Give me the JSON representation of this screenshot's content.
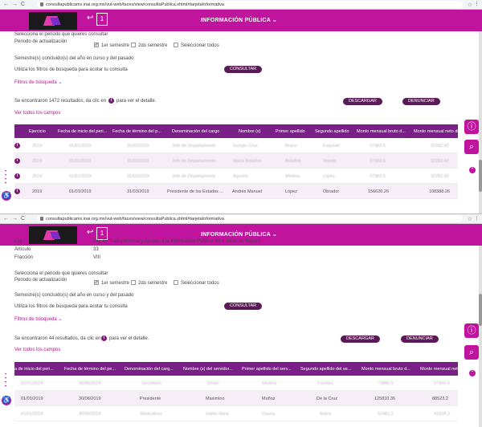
{
  "browser": {
    "url1": "consultapublicamx.inai.org.mx/vut-web/faces/view/consultaPublica.xhtml#tarjetaInformativa",
    "url2": "consultapublicamx.inai.org.mx/vut-web/faces/view/consultaPublica.xhtml#tarjetaInformativa",
    "back_glyph": "←",
    "forward_glyph": "→",
    "reload_glyph": "C",
    "star_glyph": "☆",
    "menu_glyph": "⋮"
  },
  "header": {
    "title": "INFORMACIÓN PÚBLICA ⌄",
    "back_glyph": "↩",
    "badge": "1"
  },
  "shot1": {
    "period_prompt": "Selecciona el periodo que quieres consultar",
    "period_label": "Periodo de actualización",
    "options": [
      "1er semestre",
      "2do semestre",
      "Seleccionar todos"
    ],
    "semester_note": "Semestre(s) concluido(s) del año en curso y del pasado",
    "filter_hint": "Utiliza los filtros de búsqueda para acotar tu consulta",
    "consult_button": "CONSULTAR",
    "filters_link": "Filtros de búsqueda ⌄",
    "results_text_a": "Se encontraron 1472 resultados, da clic en",
    "results_text_b": "para ver el detalle.",
    "download_button": "DESCARGAR",
    "report_button": "DENUNCIAR",
    "all_fields_link": "Ver todos los campos",
    "columns": [
      "Ejercicio",
      "Fecha de inicio del peri...",
      "Fecha de término del p...",
      "Denominación del cargo",
      "Nombre (s)",
      "Primer apellido",
      "Segundo apellido",
      "Monto mensual bruto d...",
      "Monto mensual neto de..."
    ],
    "rows": [
      [
        "2019",
        "01/01/2019",
        "31/03/2019",
        "Jefe de Departamento",
        "Giorgio Cruz",
        "Bravo",
        "Esquivel",
        "37983.5",
        "32282.42"
      ],
      [
        "2019",
        "01/01/2019",
        "31/03/2019",
        "Jefe de Departamento",
        "María Bolaños",
        "Bolaños",
        "Tejeda",
        "37983.5",
        "32282.42"
      ],
      [
        "2019",
        "01/01/2019",
        "31/03/2019",
        "Jefe de Departamento",
        "Agustín",
        "Medina",
        "López",
        "37983.5",
        "32282.42"
      ],
      [
        "2019",
        "01/01/2019",
        "31/03/2019",
        "Presidente de los Estados ...",
        "Andrés Manuel",
        "López",
        "Obrador",
        "156620.26",
        "108388.26"
      ]
    ]
  },
  "shot2": {
    "law_label": "Ley",
    "law_value": "Ley de Transparencia y Acceso a la Información Pública del Estado de Nayarit",
    "article_label": "Artículo",
    "article_value": "33",
    "fraction_label": "Fracción",
    "fraction_value": "VIII",
    "period_prompt": "Selecciona el periodo que quieres consultar",
    "period_label": "Periodo de actualización",
    "options": [
      "1er semestre",
      "2do semestre",
      "Seleccionar todos"
    ],
    "semester_note": "Semestre(s) concluido(s) del año en curso y del pasado",
    "filter_hint": "Utiliza los filtros de búsqueda para acotar tu consulta",
    "consult_button": "CONSULTAR",
    "filters_link": "Filtros de búsqueda ⌄",
    "results_text_a": "Se encontraron 44 resultados, da clic en",
    "results_text_b": "para ver el detalle.",
    "download_button": "DESCARGAR",
    "report_button": "DENUNCIAR",
    "all_fields_link": "Ver todos los campos",
    "columns": [
      "a de inicio del peri...",
      "Fecha de término del pe...",
      "Denominación del carg...",
      "Nombre (s) del servidor...",
      "Primer apellido del serv...",
      "Segundo apellido del se...",
      "Monto mensual bruto d...",
      "Monto mensual neto de..."
    ],
    "rows": [
      [
        "01/01/2019",
        "30/06/2019",
        "Secretario",
        "Efraín",
        "Medina",
        "Fuentes",
        "73880.5",
        "57904.5"
      ],
      [
        "01/01/2019",
        "30/06/2019",
        "Presidente",
        "Maximino",
        "Muñoz",
        "De la Cruz",
        "125810.36",
        "88523.2"
      ],
      [
        "01/01/2019",
        "30/06/2019",
        "Sindicatura",
        "Isabel Sarai",
        "Osuna",
        "Ibarra",
        "52481.1",
        "41628.3"
      ]
    ]
  },
  "icons": {
    "info": "i",
    "fab_info": "ⓘ",
    "fab_search": "⌕",
    "fab_up": "⌃",
    "accessibility": "♿"
  }
}
